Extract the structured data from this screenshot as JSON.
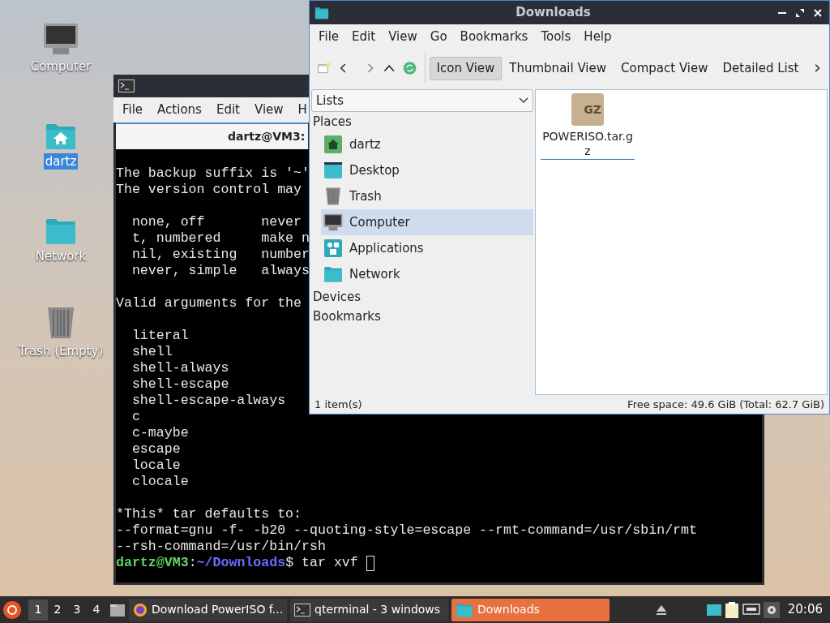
{
  "desktop": {
    "icons": [
      {
        "kind": "computer",
        "label": "Computer",
        "selected": false
      },
      {
        "kind": "home",
        "label": "dartz",
        "selected": true
      },
      {
        "kind": "folder",
        "label": "Network",
        "selected": false
      },
      {
        "kind": "trash",
        "label": "Trash (Empty)",
        "selected": false
      }
    ]
  },
  "terminal": {
    "menu": [
      "File",
      "Actions",
      "Edit",
      "View",
      "H"
    ],
    "tab_title": "dartz@VM3:",
    "lines": [
      {
        "kind": "text",
        "text": "The backup suffix is '~'"
      },
      {
        "kind": "text",
        "text": "The version control may"
      },
      {
        "kind": "blank"
      },
      {
        "kind": "text",
        "text": "  none, off       never"
      },
      {
        "kind": "text",
        "text": "  t, numbered     make n"
      },
      {
        "kind": "text",
        "text": "  nil, existing   number"
      },
      {
        "kind": "text",
        "text": "  never, simple   always"
      },
      {
        "kind": "blank"
      },
      {
        "kind": "text",
        "text": "Valid arguments for the"
      },
      {
        "kind": "blank"
      },
      {
        "kind": "text",
        "text": "  literal"
      },
      {
        "kind": "text",
        "text": "  shell"
      },
      {
        "kind": "text",
        "text": "  shell-always"
      },
      {
        "kind": "text",
        "text": "  shell-escape"
      },
      {
        "kind": "text",
        "text": "  shell-escape-always"
      },
      {
        "kind": "text",
        "text": "  c"
      },
      {
        "kind": "text",
        "text": "  c-maybe"
      },
      {
        "kind": "text",
        "text": "  escape"
      },
      {
        "kind": "text",
        "text": "  locale"
      },
      {
        "kind": "text",
        "text": "  clocale"
      },
      {
        "kind": "blank"
      },
      {
        "kind": "text",
        "text": "*This* tar defaults to:"
      },
      {
        "kind": "text",
        "text": "--format=gnu -f- -b20 --quoting-style=escape --rmt-command=/usr/sbin/rmt"
      },
      {
        "kind": "text",
        "text": "--rsh-command=/usr/bin/rsh"
      },
      {
        "kind": "prompt",
        "user": "dartz@VM3",
        "sep": ":",
        "path": "~/Downloads",
        "command": "$ tar xvf "
      }
    ]
  },
  "file_manager": {
    "title": "Downloads",
    "menu": [
      "File",
      "Edit",
      "View",
      "Go",
      "Bookmarks",
      "Tools",
      "Help"
    ],
    "views": [
      {
        "label": "Icon View",
        "selected": true
      },
      {
        "label": "Thumbnail View",
        "selected": false
      },
      {
        "label": "Compact View",
        "selected": false
      },
      {
        "label": "Detailed List",
        "selected": false
      }
    ],
    "sidebar": {
      "dropdown": "Lists",
      "sections": [
        {
          "title": "Places",
          "items": [
            {
              "kind": "home",
              "label": "dartz",
              "selected": false
            },
            {
              "kind": "desktop",
              "label": "Desktop",
              "selected": false
            },
            {
              "kind": "trash",
              "label": "Trash",
              "selected": false
            },
            {
              "kind": "computer",
              "label": "Computer",
              "selected": true
            },
            {
              "kind": "apps",
              "label": "Applications",
              "selected": false
            },
            {
              "kind": "folder",
              "label": "Network",
              "selected": false
            }
          ]
        },
        {
          "title": "Devices"
        },
        {
          "title": "Bookmarks"
        }
      ]
    },
    "files": [
      {
        "badge": "GZ",
        "name": "POWERISO.tar.gz",
        "selected": true
      }
    ],
    "status_left": "1 item(s)",
    "status_right": "Free space: 49.6 GiB (Total: 62.7 GiB)"
  },
  "taskbar": {
    "workspaces": [
      {
        "label": "1",
        "selected": true
      },
      {
        "label": "2",
        "selected": false
      },
      {
        "label": "3",
        "selected": false
      },
      {
        "label": "4",
        "selected": false
      }
    ],
    "tasks": [
      {
        "kind": "browser",
        "label": "Download PowerISO f...",
        "selected": false
      },
      {
        "kind": "terminal",
        "label": "qterminal - 3 windows",
        "selected": false
      },
      {
        "kind": "folder",
        "label": "Downloads",
        "selected": true
      }
    ],
    "clock": "20:06"
  }
}
